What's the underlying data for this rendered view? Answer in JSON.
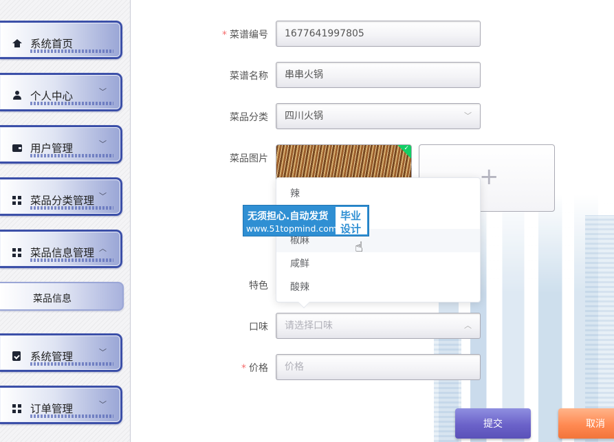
{
  "sidebar": {
    "items": [
      {
        "label": "系统首页",
        "icon": "home-icon",
        "expanded": null
      },
      {
        "label": "个人中心",
        "icon": "user-icon",
        "expanded": false
      },
      {
        "label": "用户管理",
        "icon": "wallet-icon",
        "expanded": false
      },
      {
        "label": "菜品分类管理",
        "icon": "grid-icon",
        "expanded": false
      },
      {
        "label": "菜品信息管理",
        "icon": "grid-icon",
        "expanded": true
      },
      {
        "label": "系统管理",
        "icon": "clipboard-check-icon",
        "expanded": false
      },
      {
        "label": "订单管理",
        "icon": "grid-icon",
        "expanded": false
      }
    ],
    "submenu": {
      "label": "菜品信息"
    }
  },
  "form": {
    "recipe_no": {
      "label": "菜谱编号",
      "required": true,
      "value": "1677641997805"
    },
    "recipe_name": {
      "label": "菜谱名称",
      "value": "串串火锅"
    },
    "category": {
      "label": "菜品分类",
      "value": "四川火锅"
    },
    "image": {
      "label": "菜品图片",
      "upload_symbol": "+"
    },
    "feature": {
      "label": "特色"
    },
    "taste": {
      "label": "口味",
      "placeholder": "请选择口味"
    },
    "price": {
      "label": "价格",
      "required": true,
      "placeholder": "价格"
    },
    "required_mark": "*"
  },
  "taste_dropdown": {
    "options": [
      "辣",
      "椒麻",
      "咸鲜",
      "酸辣"
    ],
    "hovered": "椒麻"
  },
  "watermark": {
    "line1": "无须担心.自动发货",
    "line2": "www.51topmind.com",
    "right1": "毕业",
    "right2": "设计"
  },
  "buttons": {
    "submit": "提交",
    "cancel": "取消"
  },
  "colors": {
    "sidebar_border": "#3b4fa8",
    "required": "#f56c6c",
    "submit": "#6b62c9",
    "cancel": "#ff8a52",
    "watermark": "#2f8fd3"
  }
}
